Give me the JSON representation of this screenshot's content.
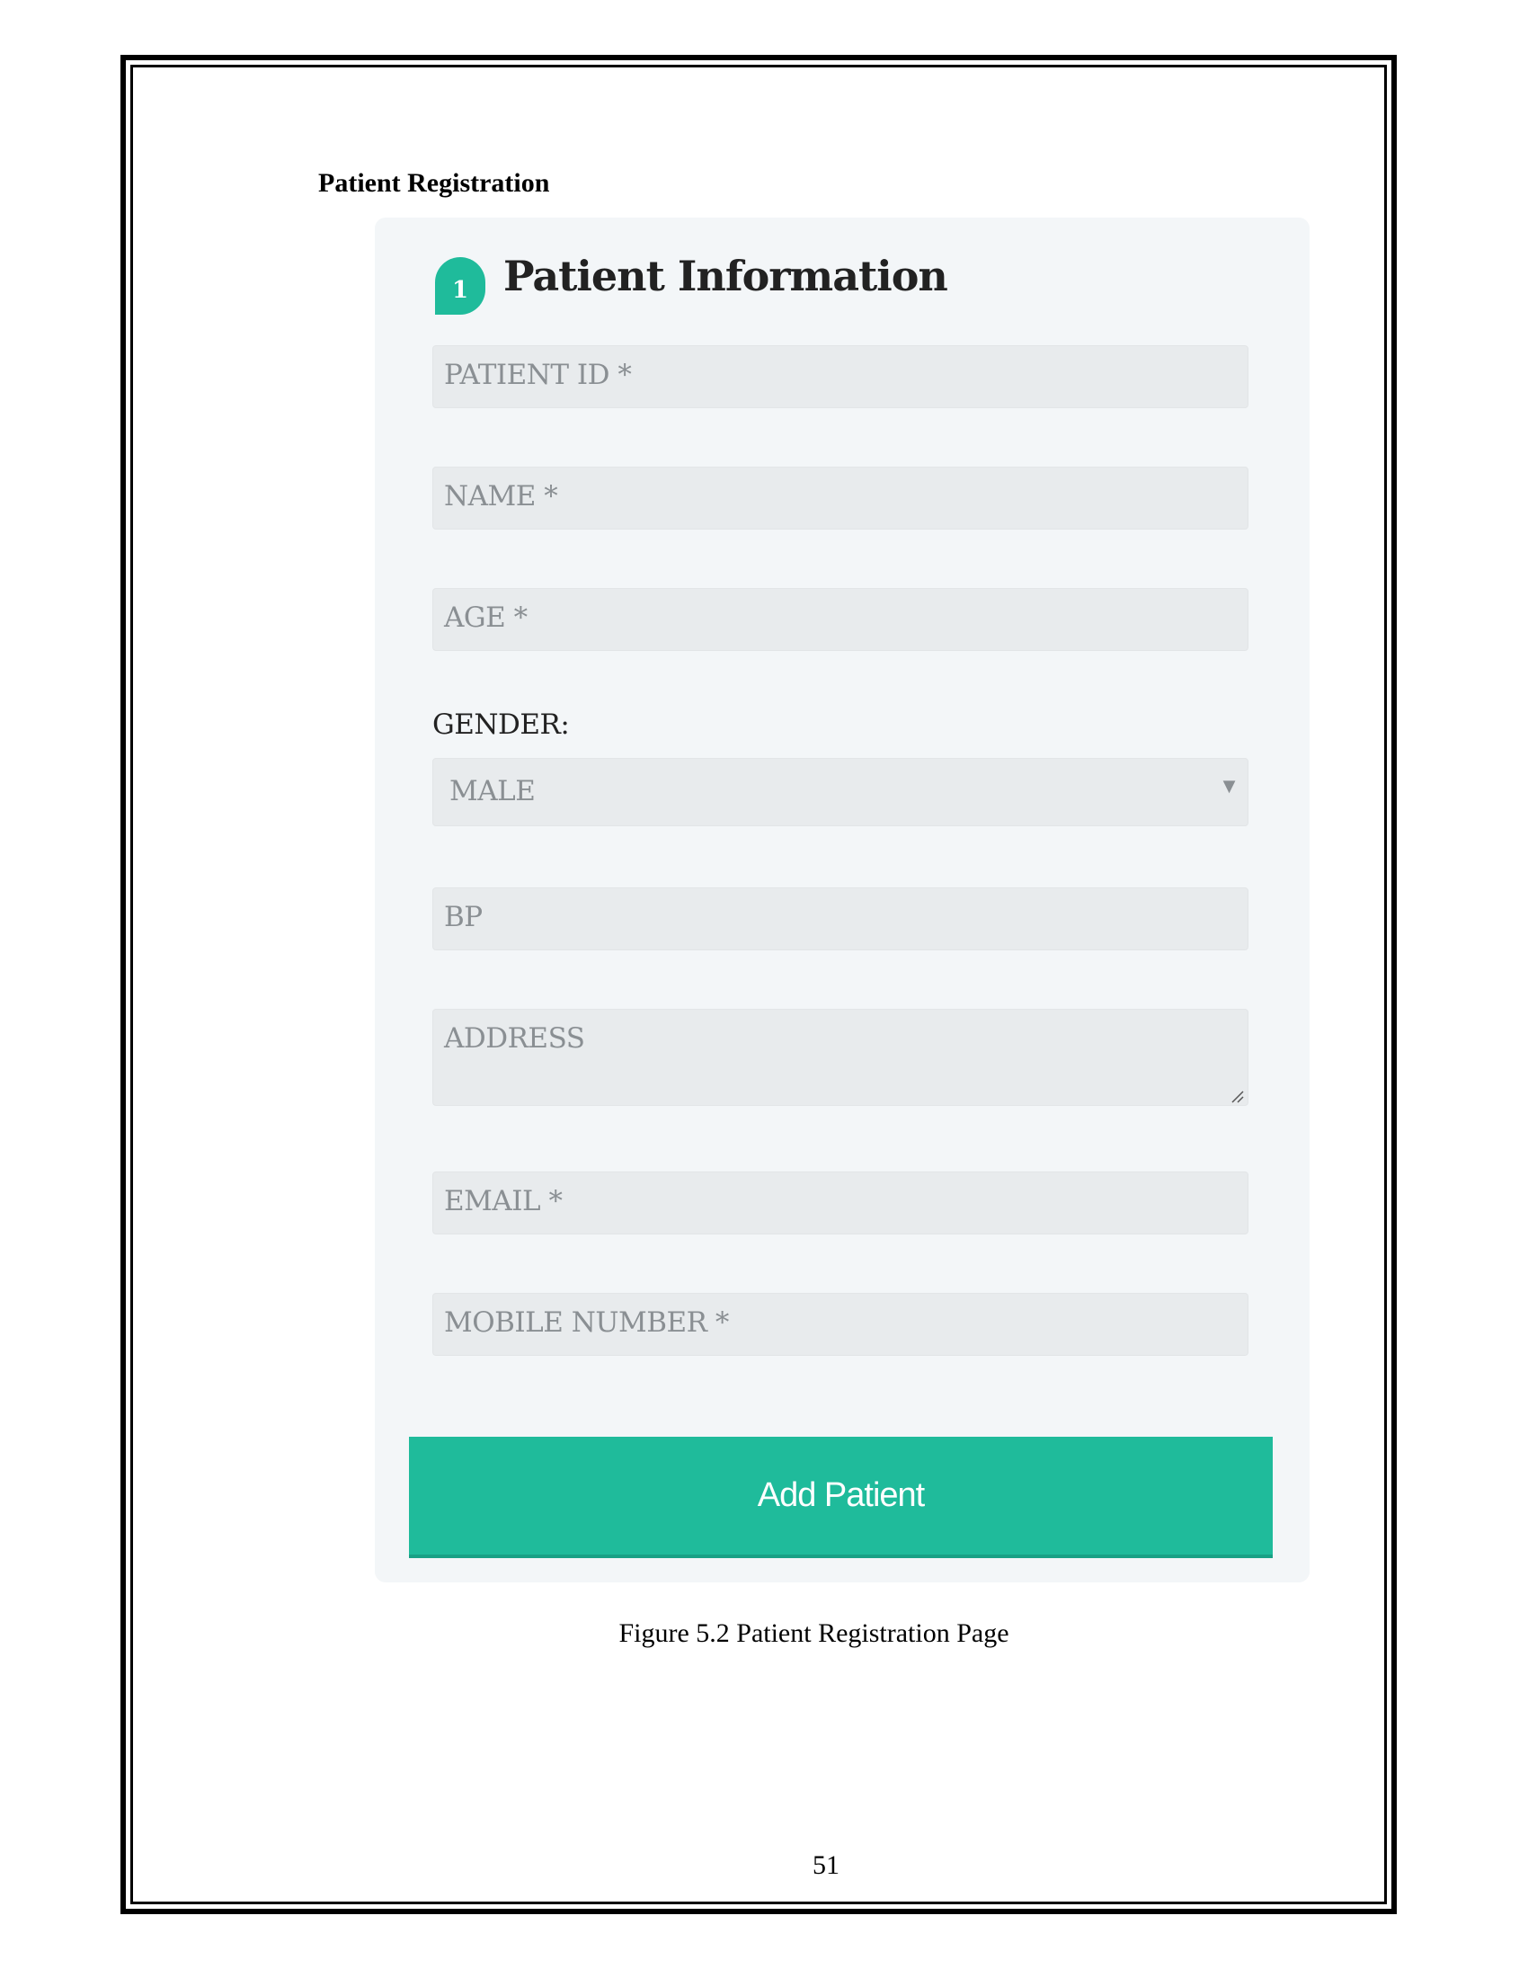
{
  "section_heading": "Patient Registration",
  "form": {
    "step_number": "1",
    "title": "Patient Information",
    "fields": {
      "patient_id_placeholder": "PATIENT ID *",
      "name_placeholder": "NAME *",
      "age_placeholder": "AGE *",
      "gender_label": "GENDER:",
      "gender_selected": "MALE",
      "bp_placeholder": "BP",
      "address_placeholder": "ADDRESS",
      "email_placeholder": "EMAIL *",
      "mobile_placeholder": "MOBILE NUMBER *"
    },
    "submit_label": "Add Patient",
    "accent_color": "#1fbb9b"
  },
  "caption": "Figure 5.2 Patient Registration Page",
  "page_number": "51"
}
